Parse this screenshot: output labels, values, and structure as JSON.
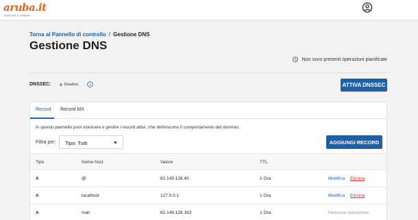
{
  "header": {
    "logo_text": "aruba.it",
    "logo_subtitle": "HOSTING E DOMINI",
    "user_icon": "user-circle-icon"
  },
  "breadcrumb": {
    "back_label": "Torna al Pannello di controllo",
    "separator": "/",
    "current": "Gestione DNS"
  },
  "page": {
    "title": "Gestione DNS",
    "no_ops_text": "Non sono presenti operazioni pianificate"
  },
  "dnssec": {
    "label": "DNSSEC:",
    "status": "Disattivo",
    "button_label": "ATTIVA DNSSEC"
  },
  "tabs": [
    {
      "label": "Record",
      "active": true
    },
    {
      "label": "Record MX",
      "active": false
    }
  ],
  "panel": {
    "description": "In questo pannello puoi visionare e gestire i record attivi, che definiscono il comportamento del dominio.",
    "filter_label": "Filtra per:",
    "filter_value": "Tipo: Tutti",
    "add_button": "AGGIUNGI RECORD"
  },
  "table": {
    "headers": [
      "Tipo",
      "Nome host",
      "Valore",
      "TTL"
    ],
    "rows": [
      {
        "type": "A",
        "host": "@",
        "value": "62.149.128.40",
        "ttl": "1 Ora",
        "edit": "Modifica",
        "delete": "Elimina"
      },
      {
        "type": "A",
        "host": "localhost",
        "value": "127.0.0.1",
        "ttl": "1 Ora",
        "edit": "Modifica",
        "delete": "Elimina"
      },
      {
        "type": "A",
        "host": "mail",
        "value": "62.149.128.163",
        "ttl": "1 Ora",
        "none": "Nessuna operazione"
      }
    ]
  },
  "colors": {
    "brand_orange": "#e2631d",
    "primary_blue": "#1d5fa8",
    "danger_red": "#d42a2a"
  }
}
